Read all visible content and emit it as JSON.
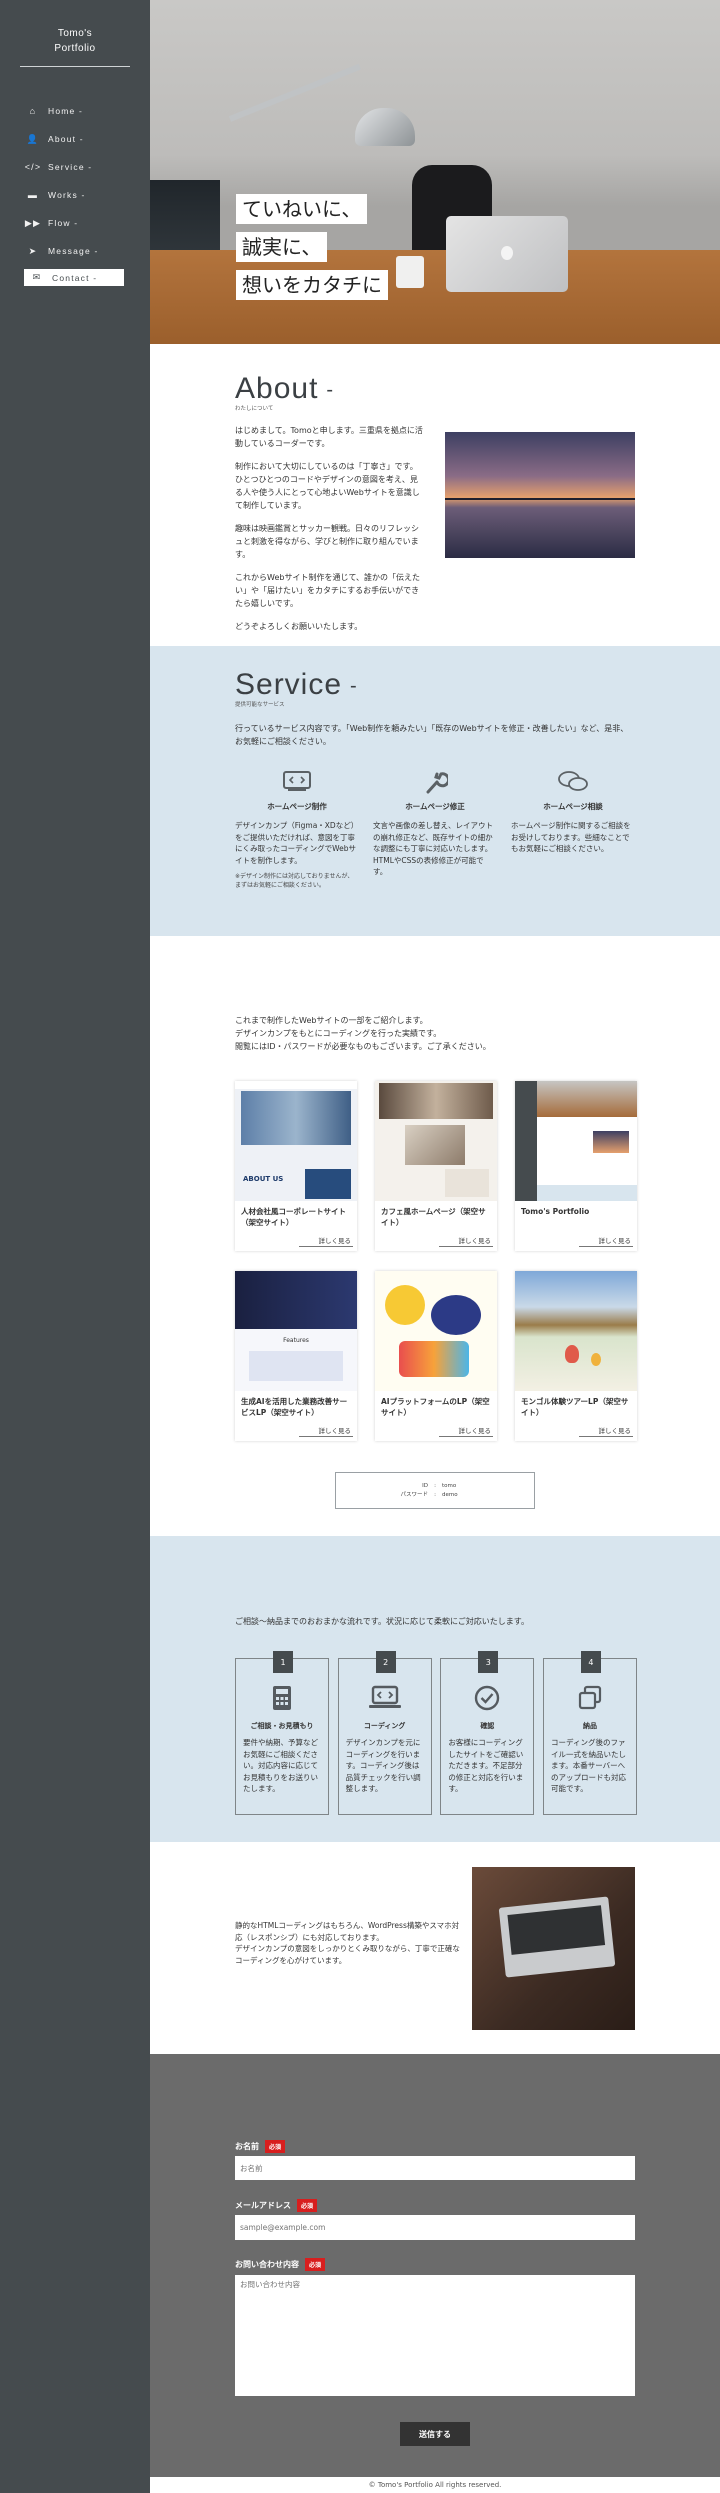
{
  "brand": {
    "line1": "Tomo's",
    "line2": "Portfolio"
  },
  "nav": [
    {
      "label": "Home",
      "icon": "home-icon"
    },
    {
      "label": "About",
      "icon": "user-icon"
    },
    {
      "label": "Service",
      "icon": "code-icon"
    },
    {
      "label": "Works",
      "icon": "briefcase-icon"
    },
    {
      "label": "Flow",
      "icon": "fast-forward-icon"
    },
    {
      "label": "Message",
      "icon": "paper-plane-icon"
    },
    {
      "label": "Contact",
      "icon": "envelope-icon"
    }
  ],
  "hero": {
    "lines": [
      "ていねいに、",
      "誠実に、",
      "想いをカタチに"
    ]
  },
  "about": {
    "title": "About",
    "sub": "わたしについて",
    "paragraphs": [
      "はじめまして。Tomoと申します。三重県を拠点に活動しているコーダーです。",
      "制作において大切にしているのは「丁寧さ」です。ひとつひとつのコードやデザインの意図を考え、見る人や使う人にとって心地よいWebサイトを意識して制作しています。",
      "趣味は映画鑑賞とサッカー観戦。日々のリフレッシュと刺激を得ながら、学びと制作に取り組んでいます。",
      "これからWebサイト制作を通じて、誰かの「伝えたい」や「届けたい」をカタチにするお手伝いができたら嬉しいです。",
      "どうぞよろしくお願いいたします。"
    ]
  },
  "service": {
    "title": "Service",
    "sub": "提供可能なサービス",
    "lead": "行っているサービス内容です。「Web制作を頼みたい」「既存のWebサイトを修正・改善したい」など、是非、お気軽にご相談ください。",
    "items": [
      {
        "icon": "code-window-icon",
        "title": "ホームページ制作",
        "desc": "デザインカンプ（Figma・XDなど）をご提供いただければ、意図を丁寧にくみ取ったコーディングでWebサイトを制作します。",
        "note": "※デザイン制作には対応しておりませんが、まずはお気軽にご相談ください。"
      },
      {
        "icon": "wrench-icon",
        "title": "ホームページ修正",
        "desc": "文言や画像の差し替え、レイアウトの崩れ修正など、既存サイトの細かな調整にも丁寧に対応いたします。HTMLやCSSの表修修正が可能です。",
        "note": ""
      },
      {
        "icon": "chat-bubbles-icon",
        "title": "ホームページ相談",
        "desc": "ホームページ制作に関するご相談をお受けしております。些細なことでもお気軽にご相談ください。",
        "note": ""
      }
    ]
  },
  "works": {
    "lead": [
      "これまで制作したWebサイトの一部をご紹介します。",
      "デザインカンプをもとにコーディングを行った実績です。",
      "閲覧にはID・パスワードが必要なものもございます。ご了承ください。"
    ],
    "more_label": "詳しく見る",
    "items": [
      {
        "title": "人材会社風コーポレートサイト（架空サイト）",
        "thumb": "about-us",
        "thumb_text": "ABOUT US"
      },
      {
        "title": "カフェ風ホームページ（架空サイト）",
        "thumb": "cafe",
        "thumb_text": ""
      },
      {
        "title": "Tomo's Portfolio",
        "thumb": "portfolio",
        "thumb_text": ""
      },
      {
        "title": "生成AIを活用した業務改善サービスLP（架空サイト）",
        "thumb": "ai-lp",
        "thumb_text": "Features"
      },
      {
        "title": "AIプラットフォームのLP（架空サイト）",
        "thumb": "ai-platform",
        "thumb_text": ""
      },
      {
        "title": "モンゴル体験ツアーLP（架空サイト）",
        "thumb": "mongolia",
        "thumb_text": ""
      }
    ],
    "login": {
      "id_label": "ID",
      "id_value": "tomo",
      "pw_label": "パスワード",
      "pw_value": "demo",
      "sep": ":"
    }
  },
  "flow": {
    "lead": "ご相談〜納品までのおおまかな流れです。状況に応じて柔軟にご対応いたします。",
    "steps": [
      {
        "num": "1",
        "icon": "calculator-icon",
        "title": "ご相談・お見積もり",
        "desc": "要件や納期、予算などお気軽にご相談ください。対応内容に応じてお見積もりをお送りいたします。"
      },
      {
        "num": "2",
        "icon": "laptop-code-icon",
        "title": "コーディング",
        "desc": "デザインカンプを元にコーディングを行います。コーディング後は品質チェックを行い調整します。"
      },
      {
        "num": "3",
        "icon": "check-circle-icon",
        "title": "確認",
        "desc": "お客様にコーディングしたサイトをご確認いただきます。不足部分の修正と対応を行います。"
      },
      {
        "num": "4",
        "icon": "copy-icon",
        "title": "納品",
        "desc": "コーディング後のファイル一式を納品いたします。本番サーバーへのアップロードも対応可能です。"
      }
    ]
  },
  "message": {
    "lines": [
      "静的なHTMLコーディングはもちろん、WordPress構築やスマホ対応（レスポンシブ）にも対応しております。",
      "デザインカンプの意図をしっかりとくみ取りながら、丁寧で正確なコーディングを心がけています。"
    ]
  },
  "contact": {
    "required": "必須",
    "name_label": "お名前",
    "name_placeholder": "お名前",
    "email_label": "メールアドレス",
    "email_placeholder": "sample@example.com",
    "body_label": "お問い合わせ内容",
    "body_placeholder": "お問い合わせ内容",
    "submit": "送信する"
  },
  "footer": "© Tomo's Portfolio All rights reserved.",
  "colors": {
    "sidebar": "#454b4e",
    "light_blue": "#d8e5ee",
    "contact_bg": "#6b6b6b",
    "required_red": "#d81e1e"
  }
}
